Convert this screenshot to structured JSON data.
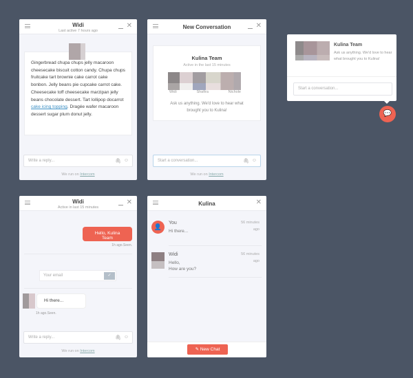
{
  "panel1": {
    "title": "Widi",
    "subtitle": "Last active 7 hours ago",
    "message_before_link": "Gingerbread chupa chups jelly macaroon cheesecake biscuit cotton candy. Chupa chups fruitcake tart brownie cake carrot cake bonbon. Jelly beans pie cupcake carrot cake. Cheesecake toff cheesecake marzipan jelly beans chocolate dessert. Tart lollipop docarrot ",
    "link": "cake icing topping",
    "message_after_link": ". Dragée wafer macaroon dessert sugar plum donut jelly.",
    "reply_placeholder": "Write a reply...",
    "footer_prefix": "We run on ",
    "footer_link": "Intercom"
  },
  "panel2": {
    "title": "New Conversation",
    "team": "Kulina Team",
    "team_status": "Active in the last 15 minutes",
    "members": [
      "Widi",
      "Shafira",
      "Nichole"
    ],
    "intro": "Ask us anything. We'd love to hear what brought you to Kulina!",
    "input_placeholder": "Start a conversation...",
    "footer_prefix": "We run on ",
    "footer_link": "Intercom"
  },
  "panel3": {
    "team": "Kulina Team",
    "intro": "Ask us anything. We'd love to hear what brought you to Kulina!",
    "input_placeholder": "Start a conversation...",
    "launcher_icon": "chat-bubbles-icon",
    "accent": "#ee6352"
  },
  "panel4": {
    "title": "Widi",
    "subtitle": "Active in last 15 minutes",
    "sent_message": "Hello, Kulina Team",
    "sent_meta": "1h ago.Seen.",
    "email_placeholder": "Your email",
    "received_message": "Hi there...",
    "received_meta": "1h ago.Seen.",
    "reply_placeholder": "Write a reply...",
    "footer_prefix": "We run on ",
    "footer_link": "Intercom"
  },
  "panel5": {
    "title": "Kulina",
    "conversations": [
      {
        "name": "You",
        "preview": "Hi there...",
        "time": "56 minutes ago"
      },
      {
        "name": "Widi",
        "preview_line1": "Hello,",
        "preview_line2": "How are you?",
        "time": "56 minutes ago"
      }
    ],
    "new_chat_label": "New Chat"
  }
}
